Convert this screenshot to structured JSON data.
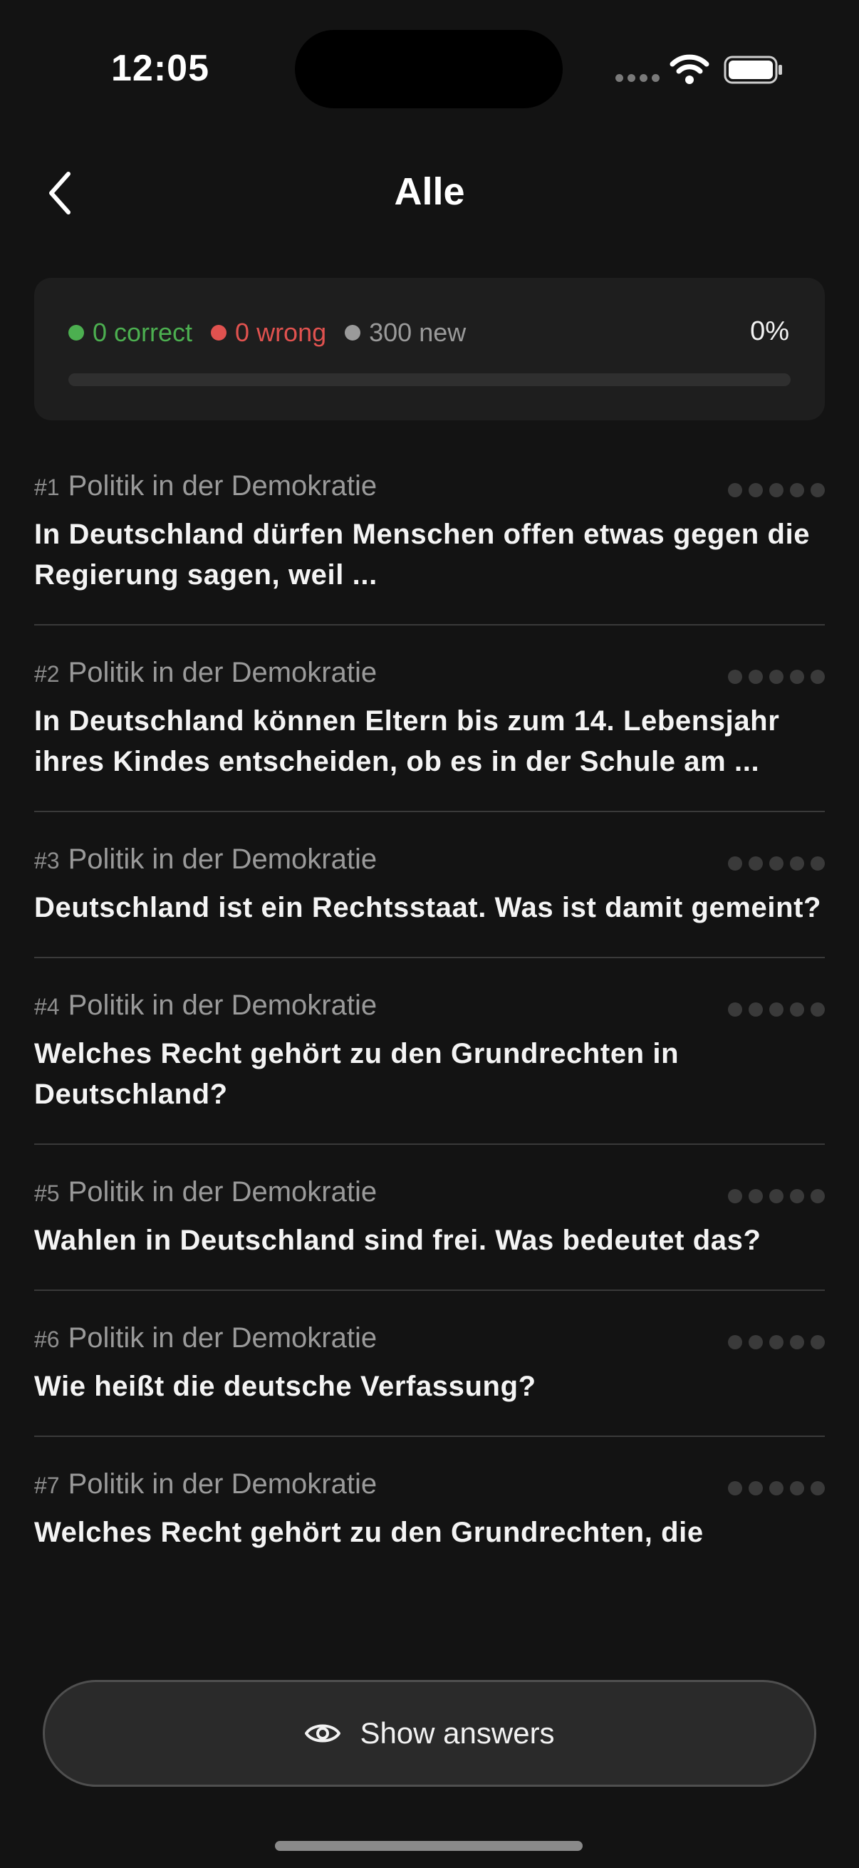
{
  "status_bar": {
    "time": "12:05"
  },
  "header": {
    "title": "Alle"
  },
  "progress": {
    "correct_label": "0 correct",
    "wrong_label": "0 wrong",
    "new_label": "300 new",
    "percent_label": "0%",
    "progress_fraction": 0
  },
  "colors": {
    "correct": "#4caf50",
    "wrong": "#e0524f",
    "new": "#9a9a9a"
  },
  "questions": [
    {
      "number": "#1",
      "category": "Politik in der Demokratie",
      "text": "In Deutschland dürfen Menschen offen etwas gegen die Regierung sagen, weil ..."
    },
    {
      "number": "#2",
      "category": "Politik in der Demokratie",
      "text": "In Deutschland können Eltern bis zum 14. Lebensjahr ihres Kindes entscheiden, ob es in der Schule am ..."
    },
    {
      "number": "#3",
      "category": "Politik in der Demokratie",
      "text": "Deutschland ist ein Rechtsstaat. Was ist damit gemeint?"
    },
    {
      "number": "#4",
      "category": "Politik in der Demokratie",
      "text": "Welches Recht gehört zu den Grundrechten in Deutschland?"
    },
    {
      "number": "#5",
      "category": "Politik in der Demokratie",
      "text": "Wahlen in Deutschland sind frei. Was bedeutet das?"
    },
    {
      "number": "#6",
      "category": "Politik in der Demokratie",
      "text": "Wie heißt die deutsche Verfassung?"
    },
    {
      "number": "#7",
      "category": "Politik in der Demokratie",
      "text": "Welches Recht gehört zu den Grundrechten, die"
    }
  ],
  "footer": {
    "show_answers_label": "Show answers"
  }
}
